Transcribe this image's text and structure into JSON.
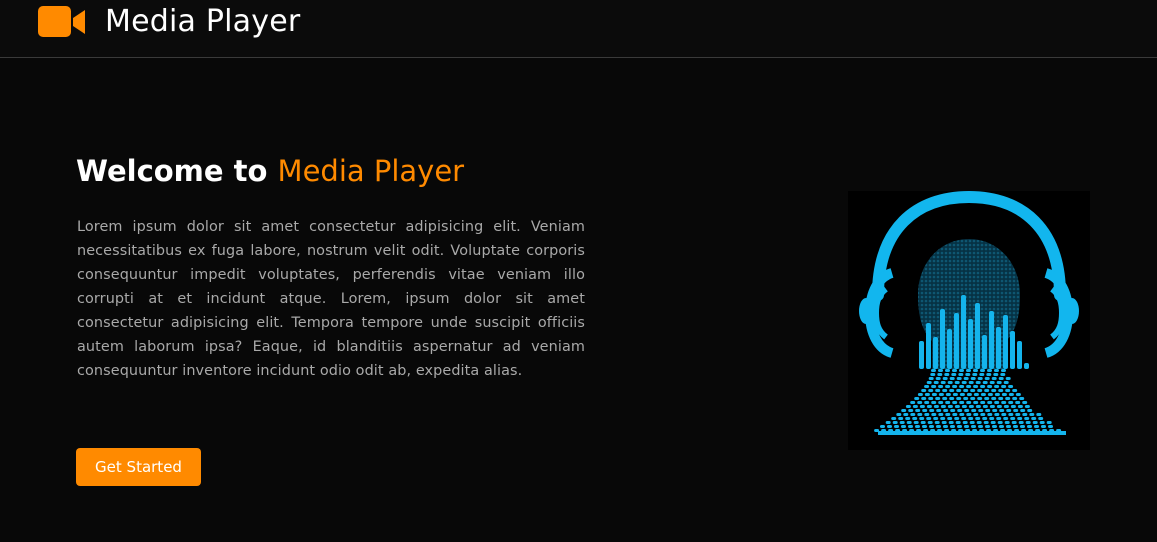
{
  "navbar": {
    "logo_icon": "video-camera-icon",
    "title": "Media Player"
  },
  "hero": {
    "heading_prefix": "Welcome to ",
    "heading_accent": "Media Player",
    "description": "Lorem ipsum dolor sit amet consectetur adipisicing elit. Veniam necessitatibus ex fuga labore, nostrum velit odit. Voluptate corporis consequuntur impedit voluptates, perferendis vitae veniam illo corrupti at et incidunt atque. Lorem, ipsum dolor sit amet consectetur adipisicing elit. Tempora tempore unde suscipit officiis autem laborum ipsa? Eaque, id blanditiis aspernatur ad veniam consequuntur inventore incidunt odio odit ab, expedita alias.",
    "cta_label": "Get Started",
    "illustration": "headphones-equalizer-head-illustration"
  },
  "colors": {
    "accent": "#ff8a00",
    "background": "#080808",
    "illustration_blue": "#12b6ee"
  }
}
